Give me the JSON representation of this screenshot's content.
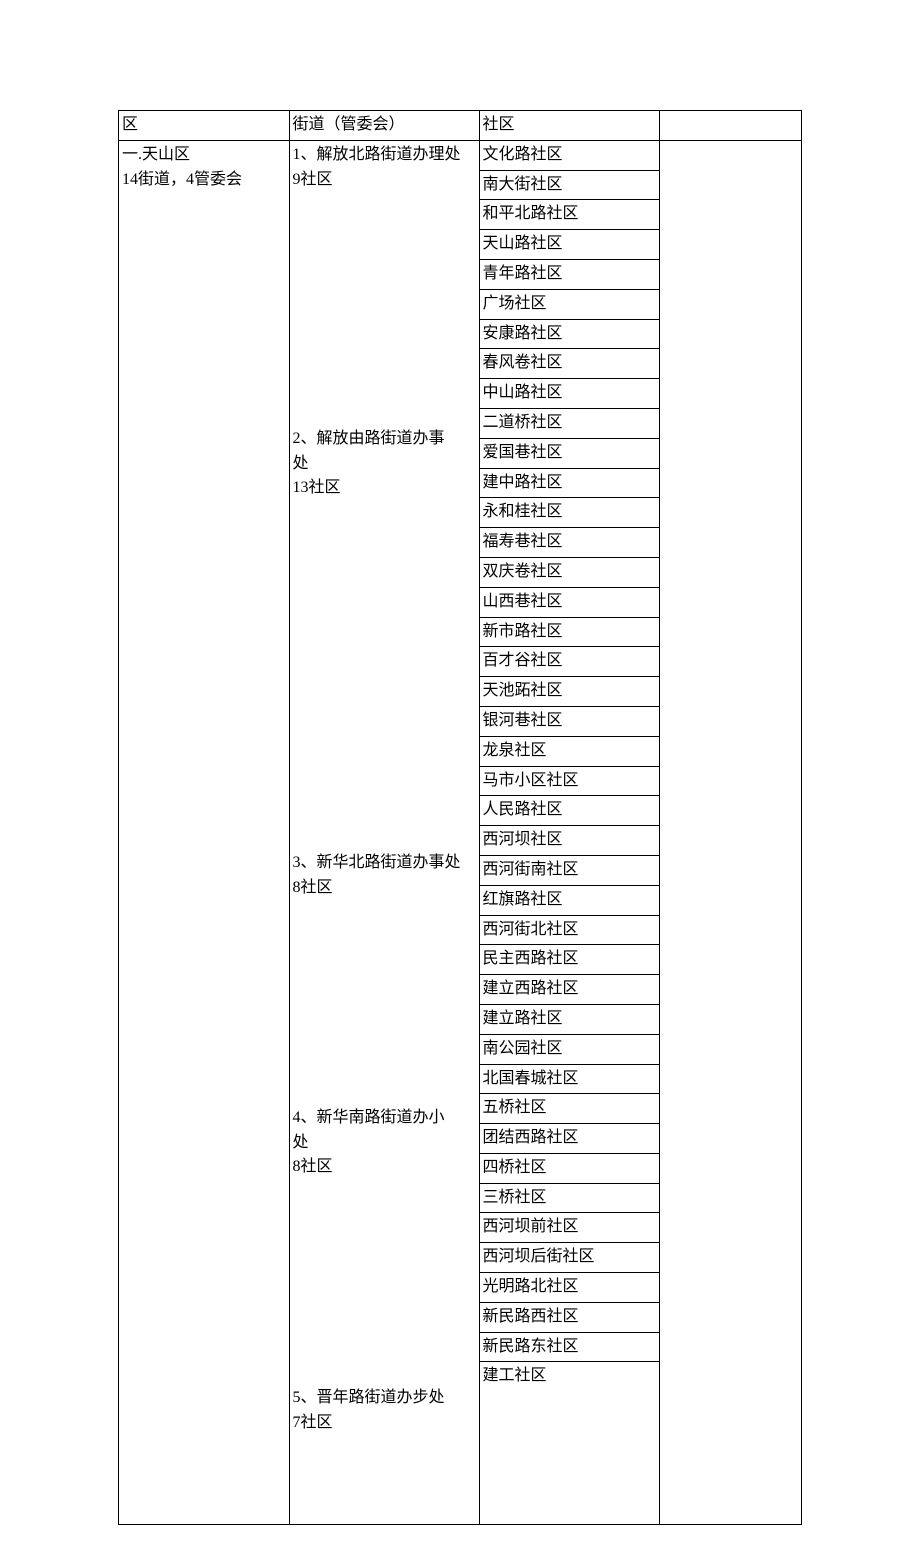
{
  "headers": {
    "col1": "区",
    "col2": "街道（管委会）",
    "col3": "社区",
    "col4": ""
  },
  "district": {
    "line1": "一.天山区",
    "line2": "14街道，4管委会"
  },
  "groups": [
    {
      "name_lines": [
        "1、解放北路街道办理处",
        "9社区"
      ],
      "communities": [
        "文化路社区",
        "南大街社区",
        "和平北路社区",
        "天山路社区",
        "青年路社区",
        "广场社区",
        "安康路社区",
        "春风卷社区",
        "中山路社区"
      ]
    },
    {
      "name_lines": [
        "2、解放由路街道办事处",
        "",
        "13社区"
      ],
      "name_display": [
        "2、解放由路街道办事",
        "处",
        "13社区"
      ],
      "communities": [
        "二道桥社区",
        "爱国巷社区",
        "建中路社区",
        "永和桂社区",
        "福寿巷社区",
        "双庆卷社区",
        "山西巷社区",
        "新市路社区",
        "百才谷社区",
        "天池跖社区",
        "银河巷社区",
        "龙泉社区",
        "马市小区社区"
      ]
    },
    {
      "name_lines": [
        "3、新华北路街道办事处",
        "8社区"
      ],
      "communities": [
        "人民路社区",
        "西河坝社区",
        "西河街南社区",
        "红旗路社区",
        "西河街北社区",
        "民主西路社区",
        "建立西路社区",
        "建立路社区"
      ]
    },
    {
      "name_lines": [
        "4、新华南路街道办小处",
        "",
        "8社区"
      ],
      "name_display": [
        "4、新华南路街道办小",
        "处",
        "8社区"
      ],
      "communities": [
        "南公园社区",
        "北国春城社区",
        "五桥社区",
        "团结西路社区",
        "四桥社区",
        "三桥社区",
        "西河坝前社区",
        "西河坝后街社区"
      ]
    },
    {
      "name_lines": [
        "5、晋年路街道办步处",
        "7社区"
      ],
      "communities": [
        "光明路北社区",
        "新民路西社区",
        "新民路东社区",
        "建工社区"
      ],
      "last_open": true
    }
  ]
}
